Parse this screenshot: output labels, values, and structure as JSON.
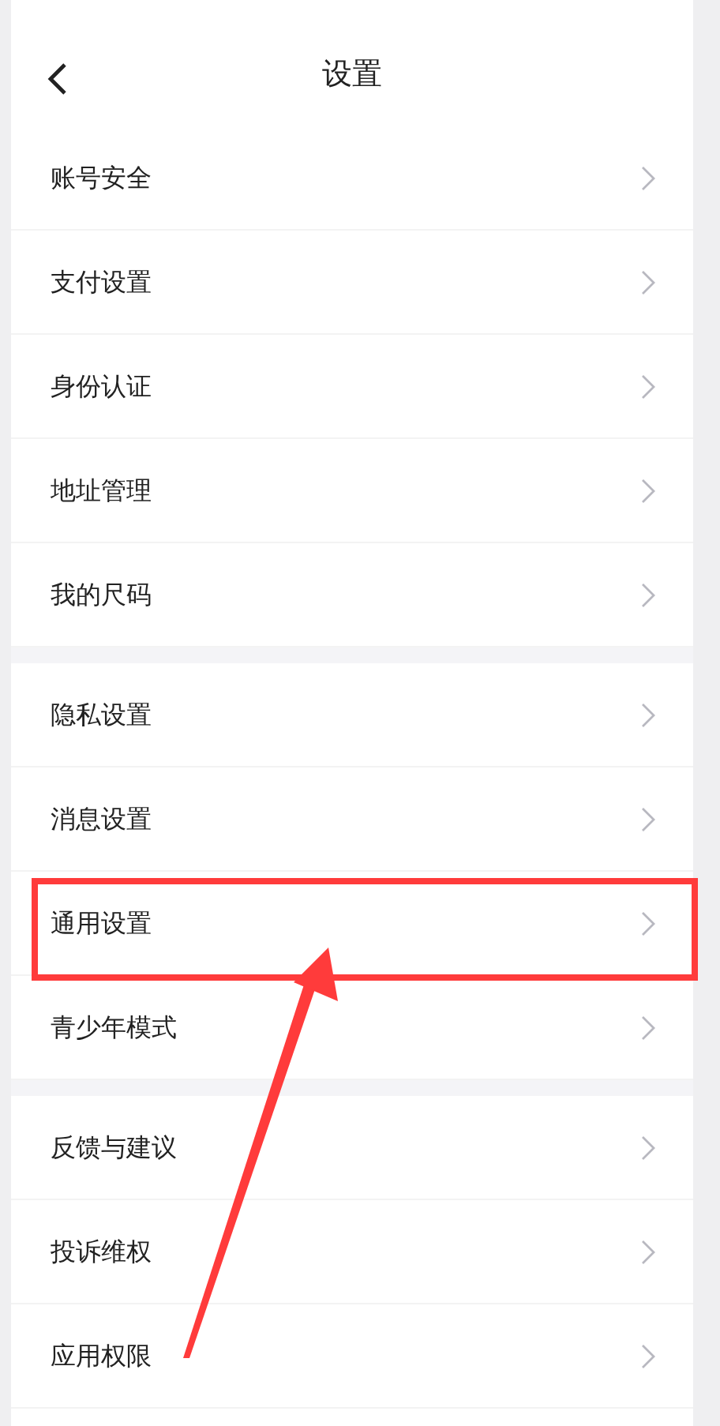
{
  "header": {
    "title": "设置"
  },
  "groups": [
    {
      "items": [
        {
          "label": "账号安全",
          "highlighted": false
        },
        {
          "label": "支付设置",
          "highlighted": false
        },
        {
          "label": "身份认证",
          "highlighted": false
        },
        {
          "label": "地址管理",
          "highlighted": false
        },
        {
          "label": "我的尺码",
          "highlighted": false
        }
      ]
    },
    {
      "items": [
        {
          "label": "隐私设置",
          "highlighted": false
        },
        {
          "label": "消息设置",
          "highlighted": false
        },
        {
          "label": "通用设置",
          "highlighted": true
        },
        {
          "label": "青少年模式",
          "highlighted": false
        }
      ]
    },
    {
      "items": [
        {
          "label": "反馈与建议",
          "highlighted": false
        },
        {
          "label": "投诉维权",
          "highlighted": false
        },
        {
          "label": "应用权限",
          "highlighted": false
        }
      ]
    }
  ]
}
